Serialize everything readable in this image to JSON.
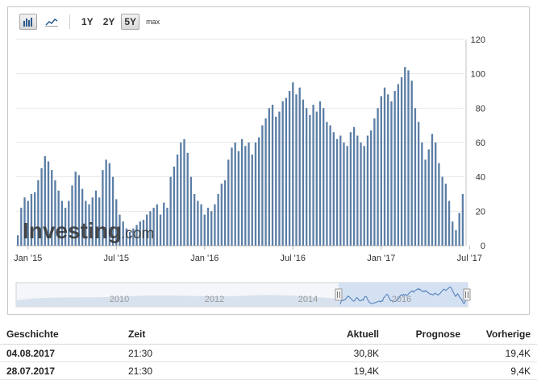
{
  "toolbar": {
    "icons": [
      "bar-chart-icon",
      "line-chart-icon"
    ],
    "ranges": [
      {
        "label": "1Y",
        "active": false
      },
      {
        "label": "2Y",
        "active": false
      },
      {
        "label": "5Y",
        "active": true
      },
      {
        "label": "max",
        "active": false
      }
    ]
  },
  "chart_data": {
    "type": "bar",
    "y_ticks": [
      "0",
      "20",
      "40",
      "60",
      "80",
      "100",
      "120"
    ],
    "ylim": [
      0,
      120
    ],
    "x_labels": [
      "Jan '15",
      "Jul '15",
      "Jan '16",
      "Jul '16",
      "Jan '17",
      "Jul '17"
    ],
    "watermark": "Investing",
    "watermark_suffix": ".com",
    "colors": {
      "bar": "#5b7ea6",
      "grid": "#e6e6e6",
      "watermark": "#333333"
    },
    "values": [
      6,
      22,
      28,
      26,
      30,
      31,
      38,
      45,
      52,
      49,
      44,
      38,
      32,
      26,
      22,
      26,
      35,
      43,
      41,
      33,
      26,
      24,
      28,
      32,
      28,
      44,
      50,
      48,
      40,
      27,
      18,
      14,
      10,
      8,
      10,
      12,
      14,
      15,
      18,
      20,
      22,
      24,
      18,
      25,
      22,
      40,
      46,
      53,
      60,
      62,
      54,
      40,
      30,
      26,
      24,
      18,
      22,
      20,
      24,
      30,
      36,
      38,
      50,
      57,
      60,
      55,
      62,
      58,
      60,
      53,
      60,
      63,
      70,
      74,
      80,
      82,
      75,
      78,
      84,
      86,
      90,
      95,
      88,
      92,
      85,
      80,
      76,
      82,
      78,
      84,
      80,
      72,
      70,
      66,
      62,
      64,
      60,
      58,
      66,
      69,
      64,
      60,
      58,
      64,
      67,
      74,
      80,
      87,
      92,
      88,
      84,
      90,
      94,
      98,
      104,
      102,
      96,
      80,
      72,
      60,
      50,
      56,
      65,
      60,
      48,
      40,
      36,
      26,
      14,
      9,
      19,
      30
    ]
  },
  "navigator": {
    "year_labels": [
      "2010",
      "2012",
      "2014",
      "2016"
    ]
  },
  "history": {
    "headers": {
      "date": "Geschichte",
      "time": "Zeit",
      "actual": "Aktuell",
      "forecast": "Prognose",
      "previous": "Vorherige"
    },
    "rows": [
      {
        "date": "04.08.2017",
        "time": "21:30",
        "actual": "30,8K",
        "forecast": "",
        "previous": "19,4K"
      },
      {
        "date": "28.07.2017",
        "time": "21:30",
        "actual": "19,4K",
        "forecast": "",
        "previous": "9,4K"
      }
    ]
  }
}
